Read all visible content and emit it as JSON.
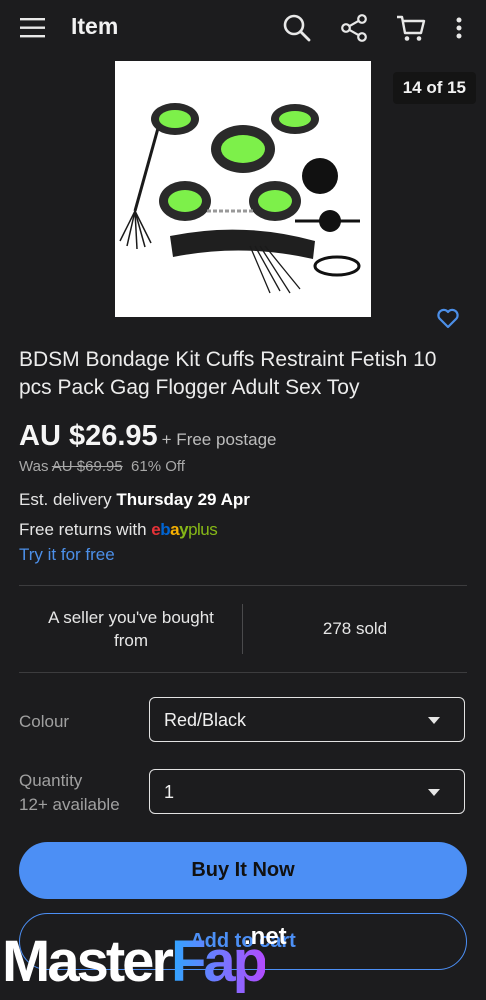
{
  "appbar": {
    "title": "Item",
    "icons": [
      "menu-icon",
      "search-icon",
      "share-icon",
      "cart-icon",
      "more-icon"
    ]
  },
  "gallery": {
    "counter": "14 of 15",
    "image": "product-photo-bondage-kit"
  },
  "product": {
    "title": "BDSM Bondage Kit Cuffs Restraint Fetish 10 pcs Pack Gag Flogger Adult Sex Toy",
    "price": "AU $26.95",
    "postage": "+ Free postage",
    "was_label": "Was",
    "was_price": "AU $69.95",
    "discount": "61% Off"
  },
  "delivery": {
    "prefix": "Est. delivery",
    "date": "Thursday 29 Apr"
  },
  "returns": {
    "text": "Free returns with",
    "brand_e": "e",
    "brand_b": "b",
    "brand_a": "a",
    "brand_y": "y",
    "brand_plus": "plus",
    "link": "Try it for free"
  },
  "seller": {
    "line1": "A seller you've bought",
    "line2": "from",
    "sold": "278 sold"
  },
  "options": {
    "colour_label": "Colour",
    "colour_value": "Red/Black",
    "quantity_label": "Quantity",
    "quantity_available": "12+ available",
    "quantity_value": "1"
  },
  "actions": {
    "buy": "Buy It Now",
    "add_cart": "Add to cart"
  },
  "watermark": {
    "part1": "Master",
    "part2": "Fap",
    "suffix": ".net"
  },
  "colors": {
    "background": "#1c1c1e",
    "accent": "#4c8ff5",
    "link": "#4c8fe8",
    "ebay_e": "#e53238",
    "ebay_b": "#0064d2",
    "ebay_a": "#f5af02",
    "ebay_y": "#86b817"
  }
}
